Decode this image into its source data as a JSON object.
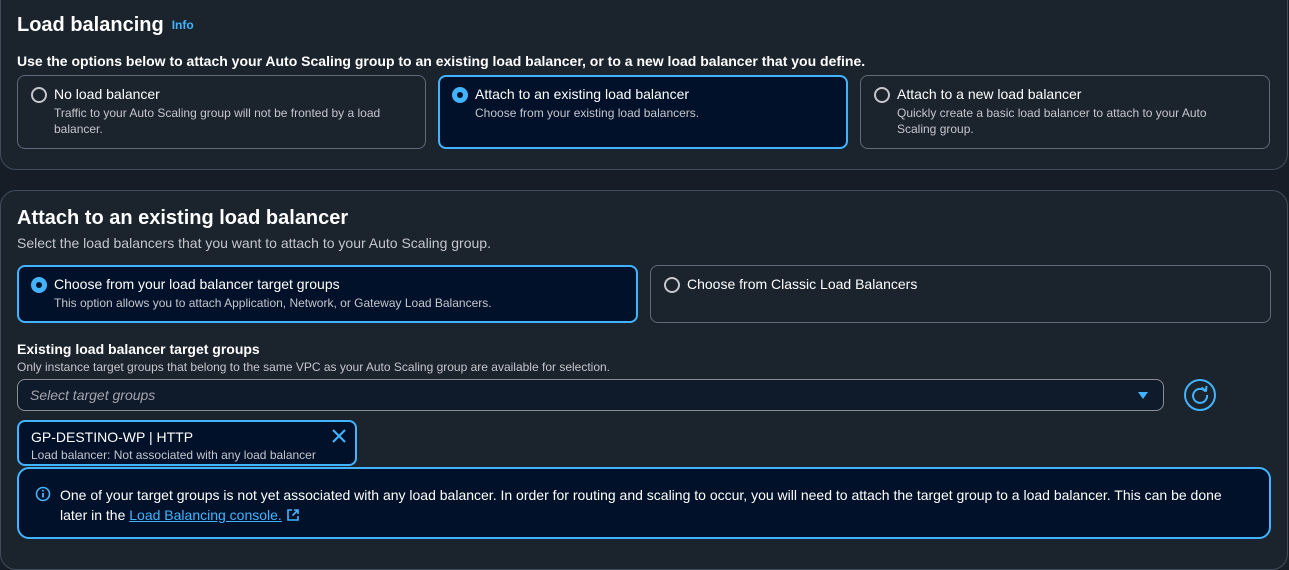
{
  "load_balancing": {
    "title": "Load balancing",
    "info": "Info",
    "description": "Use the options below to attach your Auto Scaling group to an existing load balancer, or to a new load balancer that you define.",
    "options": [
      {
        "title": "No load balancer",
        "sub": "Traffic to your Auto Scaling group will not be fronted by a load balancer.",
        "selected": false
      },
      {
        "title": "Attach to an existing load balancer",
        "sub": "Choose from your existing load balancers.",
        "selected": true
      },
      {
        "title": "Attach to a new load balancer",
        "sub": "Quickly create a basic load balancer to attach to your Auto Scaling group.",
        "selected": false
      }
    ]
  },
  "existing": {
    "title": "Attach to an existing load balancer",
    "description": "Select the load balancers that you want to attach to your Auto Scaling group.",
    "options": [
      {
        "title": "Choose from your load balancer target groups",
        "sub": "This option allows you to attach Application, Network, or Gateway Load Balancers.",
        "selected": true
      },
      {
        "title": "Choose from Classic Load Balancers",
        "sub": "",
        "selected": false
      }
    ],
    "target_groups_label": "Existing load balancer target groups",
    "target_groups_hint": "Only instance target groups that belong to the same VPC as your Auto Scaling group are available for selection.",
    "select_placeholder": "Select target groups",
    "token": {
      "title": "GP-DESTINO-WP | HTTP",
      "sub": "Load balancer: Not associated with any load balancer"
    },
    "alert": {
      "text": "One of your target groups is not yet associated with any load balancer. In order for routing and scaling to occur, you will need to attach the target group to a load balancer. This can be done later in the",
      "link": "Load Balancing console."
    }
  },
  "colors": {
    "accent": "#42b4ff",
    "background": "#161d26",
    "panel": "#1b232d",
    "selected_bg": "#001129"
  },
  "icons": [
    "radio-button",
    "caret-down-icon",
    "refresh-icon",
    "close-icon",
    "info-icon",
    "external-link-icon"
  ]
}
